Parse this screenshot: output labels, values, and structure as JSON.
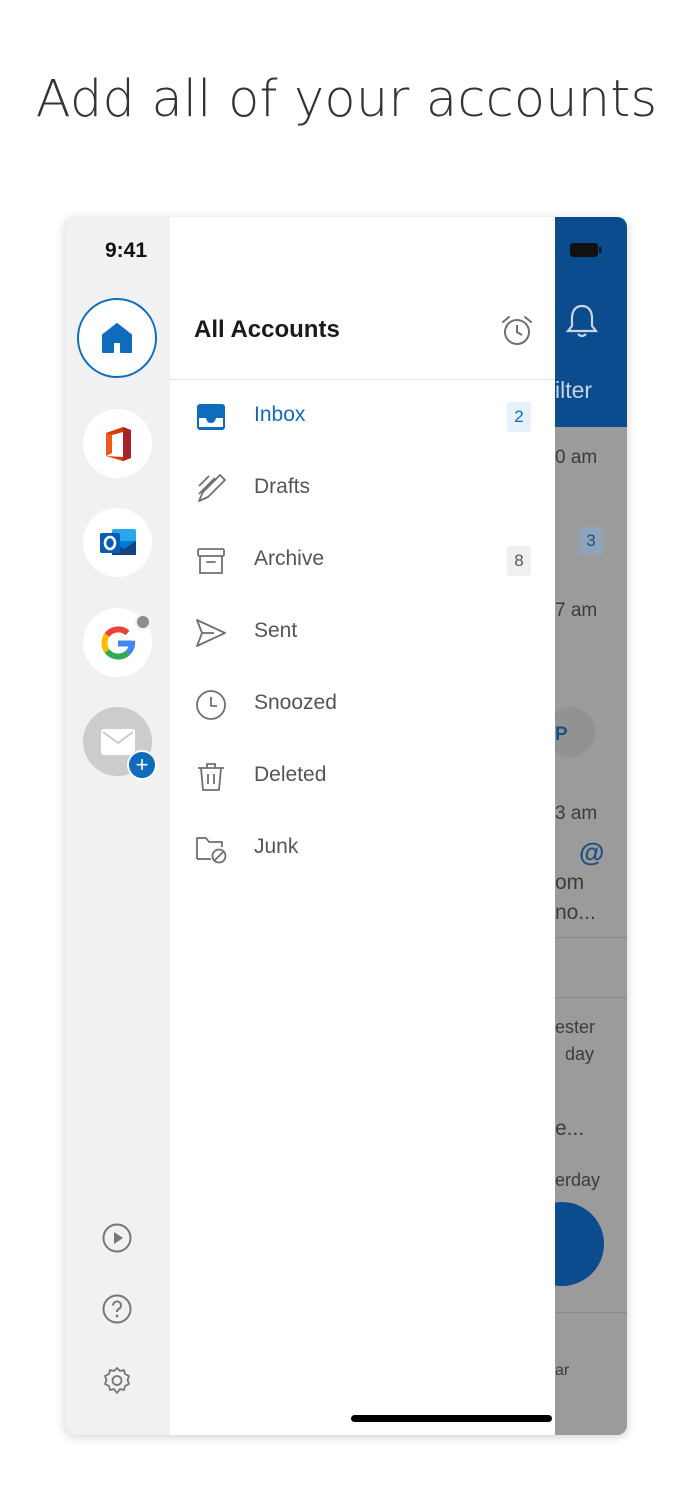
{
  "headline": "Add all of your accounts",
  "status_bar": {
    "time": "9:41"
  },
  "drawer": {
    "title": "All Accounts",
    "folders": [
      {
        "label": "Inbox",
        "count": "2",
        "icon": "inbox-icon",
        "active": true
      },
      {
        "label": "Drafts",
        "count": "",
        "icon": "drafts-icon"
      },
      {
        "label": "Archive",
        "count": "8",
        "icon": "archive-icon"
      },
      {
        "label": "Sent",
        "count": "",
        "icon": "sent-icon"
      },
      {
        "label": "Snoozed",
        "count": "",
        "icon": "snoozed-icon"
      },
      {
        "label": "Deleted",
        "count": "",
        "icon": "deleted-icon"
      },
      {
        "label": "Junk",
        "count": "",
        "icon": "junk-icon"
      }
    ]
  },
  "background_list": {
    "filter_fragment": "ilter",
    "times": [
      "0 am",
      "7 am",
      "3 am"
    ],
    "badge": "3",
    "avatar_letter": "P",
    "at_sign": "@",
    "snippets": [
      "om",
      "no...",
      "ester",
      "day",
      "e...",
      "erday",
      "...",
      "ar"
    ]
  },
  "colors": {
    "accent": "#0f6cbd",
    "header_blue": "#0b4c8f",
    "rail_bg": "#f1f1f1"
  }
}
